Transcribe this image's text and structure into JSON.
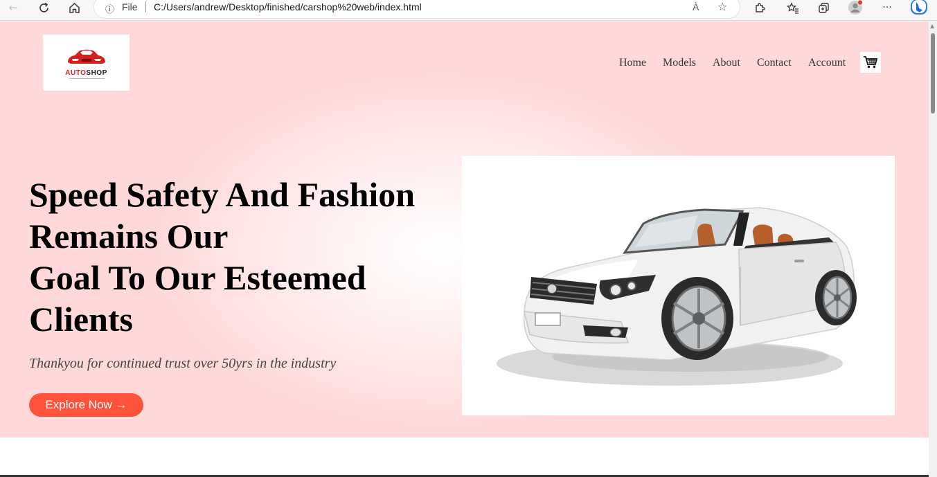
{
  "browser": {
    "file_label": "File",
    "url": "C:/Users/andrew/Desktop/finished/carshop%20web/index.html",
    "read_aloud": "À",
    "icons": [
      "back-icon",
      "refresh-icon",
      "home-icon",
      "info-icon",
      "read-aloud-icon",
      "add-favorite-icon",
      "extensions-icon",
      "favorites-icon",
      "collections-icon",
      "profile-icon",
      "more-icon",
      "bing-icon"
    ]
  },
  "logo": {
    "word_part1": "AUTO",
    "word_part2": "SHOP"
  },
  "nav": {
    "items": [
      "Home",
      "Models",
      "About",
      "Contact",
      "Account"
    ]
  },
  "hero": {
    "headline_line1": "Speed Safety And Fashion",
    "headline_line2": "Remains Our",
    "headline_line3": "Goal To Our Esteemed",
    "headline_line4": "Clients",
    "tagline": "Thankyou for continued trust over 50yrs in the industry",
    "cta_label": "Explore Now →"
  },
  "colors": {
    "accent": "#ff523b",
    "hero_bg": "#ffd9d9",
    "logo_red": "#d91c1c"
  }
}
